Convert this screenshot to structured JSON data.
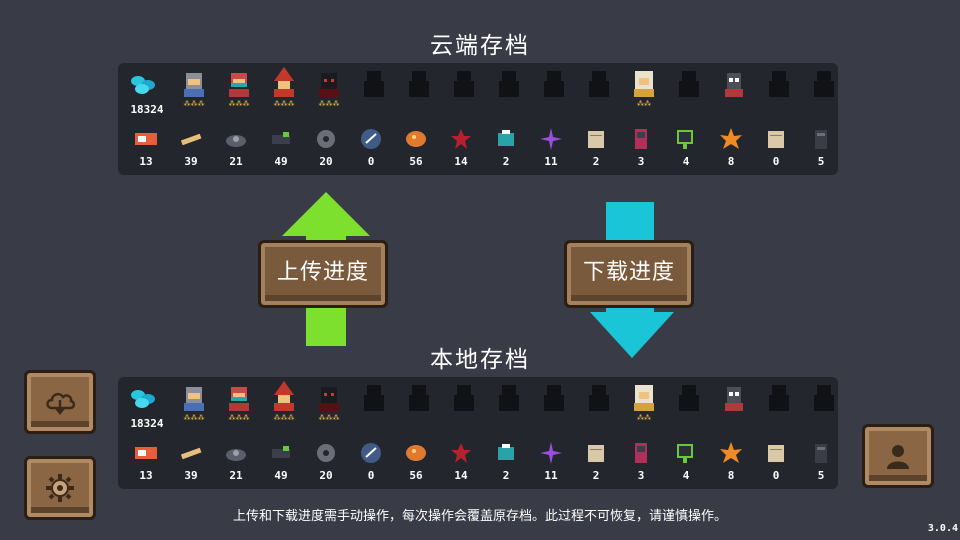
{
  "cloud": {
    "title": "云端存档",
    "gems": "18324",
    "items": [
      "13",
      "39",
      "21",
      "49",
      "20",
      "0",
      "56",
      "14",
      "2",
      "11",
      "2",
      "3",
      "4",
      "8",
      "0",
      "5"
    ]
  },
  "local": {
    "title": "本地存档",
    "gems": "18324",
    "items": [
      "13",
      "39",
      "21",
      "49",
      "20",
      "0",
      "56",
      "14",
      "2",
      "11",
      "2",
      "3",
      "4",
      "8",
      "0",
      "5"
    ]
  },
  "heroes": [
    {
      "name": "knight",
      "unlocked": true,
      "stars": "⁂⁂⁂"
    },
    {
      "name": "assassin",
      "unlocked": true,
      "stars": "⁂⁂⁂"
    },
    {
      "name": "wizard",
      "unlocked": true,
      "stars": "⁂⁂⁂"
    },
    {
      "name": "vampire",
      "unlocked": true,
      "stars": "⁂⁂⁂"
    },
    {
      "name": "locked-1",
      "unlocked": false
    },
    {
      "name": "locked-2",
      "unlocked": false
    },
    {
      "name": "locked-3",
      "unlocked": false
    },
    {
      "name": "locked-4",
      "unlocked": false
    },
    {
      "name": "locked-5",
      "unlocked": false
    },
    {
      "name": "locked-6",
      "unlocked": false
    },
    {
      "name": "priest",
      "unlocked": true,
      "stars": "⁂⁂"
    },
    {
      "name": "locked-7",
      "unlocked": false
    },
    {
      "name": "robot",
      "unlocked": true,
      "stars": ""
    },
    {
      "name": "locked-8",
      "unlocked": false
    },
    {
      "name": "locked-9",
      "unlocked": false
    }
  ],
  "buttons": {
    "upload": "上传进度",
    "download": "下载进度"
  },
  "footer": "上传和下载进度需手动操作，每次操作会覆盖原存档。此过程不可恢复，请谨慎操作。",
  "version": "3.0.4",
  "colors": {
    "background": "#393b46",
    "panel": "#24262e",
    "upload_arrow": "#7ee02e",
    "download_arrow": "#19c5d6",
    "button_wood": "#7a5a3c"
  },
  "icons": {
    "cloud_button": "cloud-download-icon",
    "settings_button": "gear-icon",
    "profile_button": "user-icon"
  }
}
